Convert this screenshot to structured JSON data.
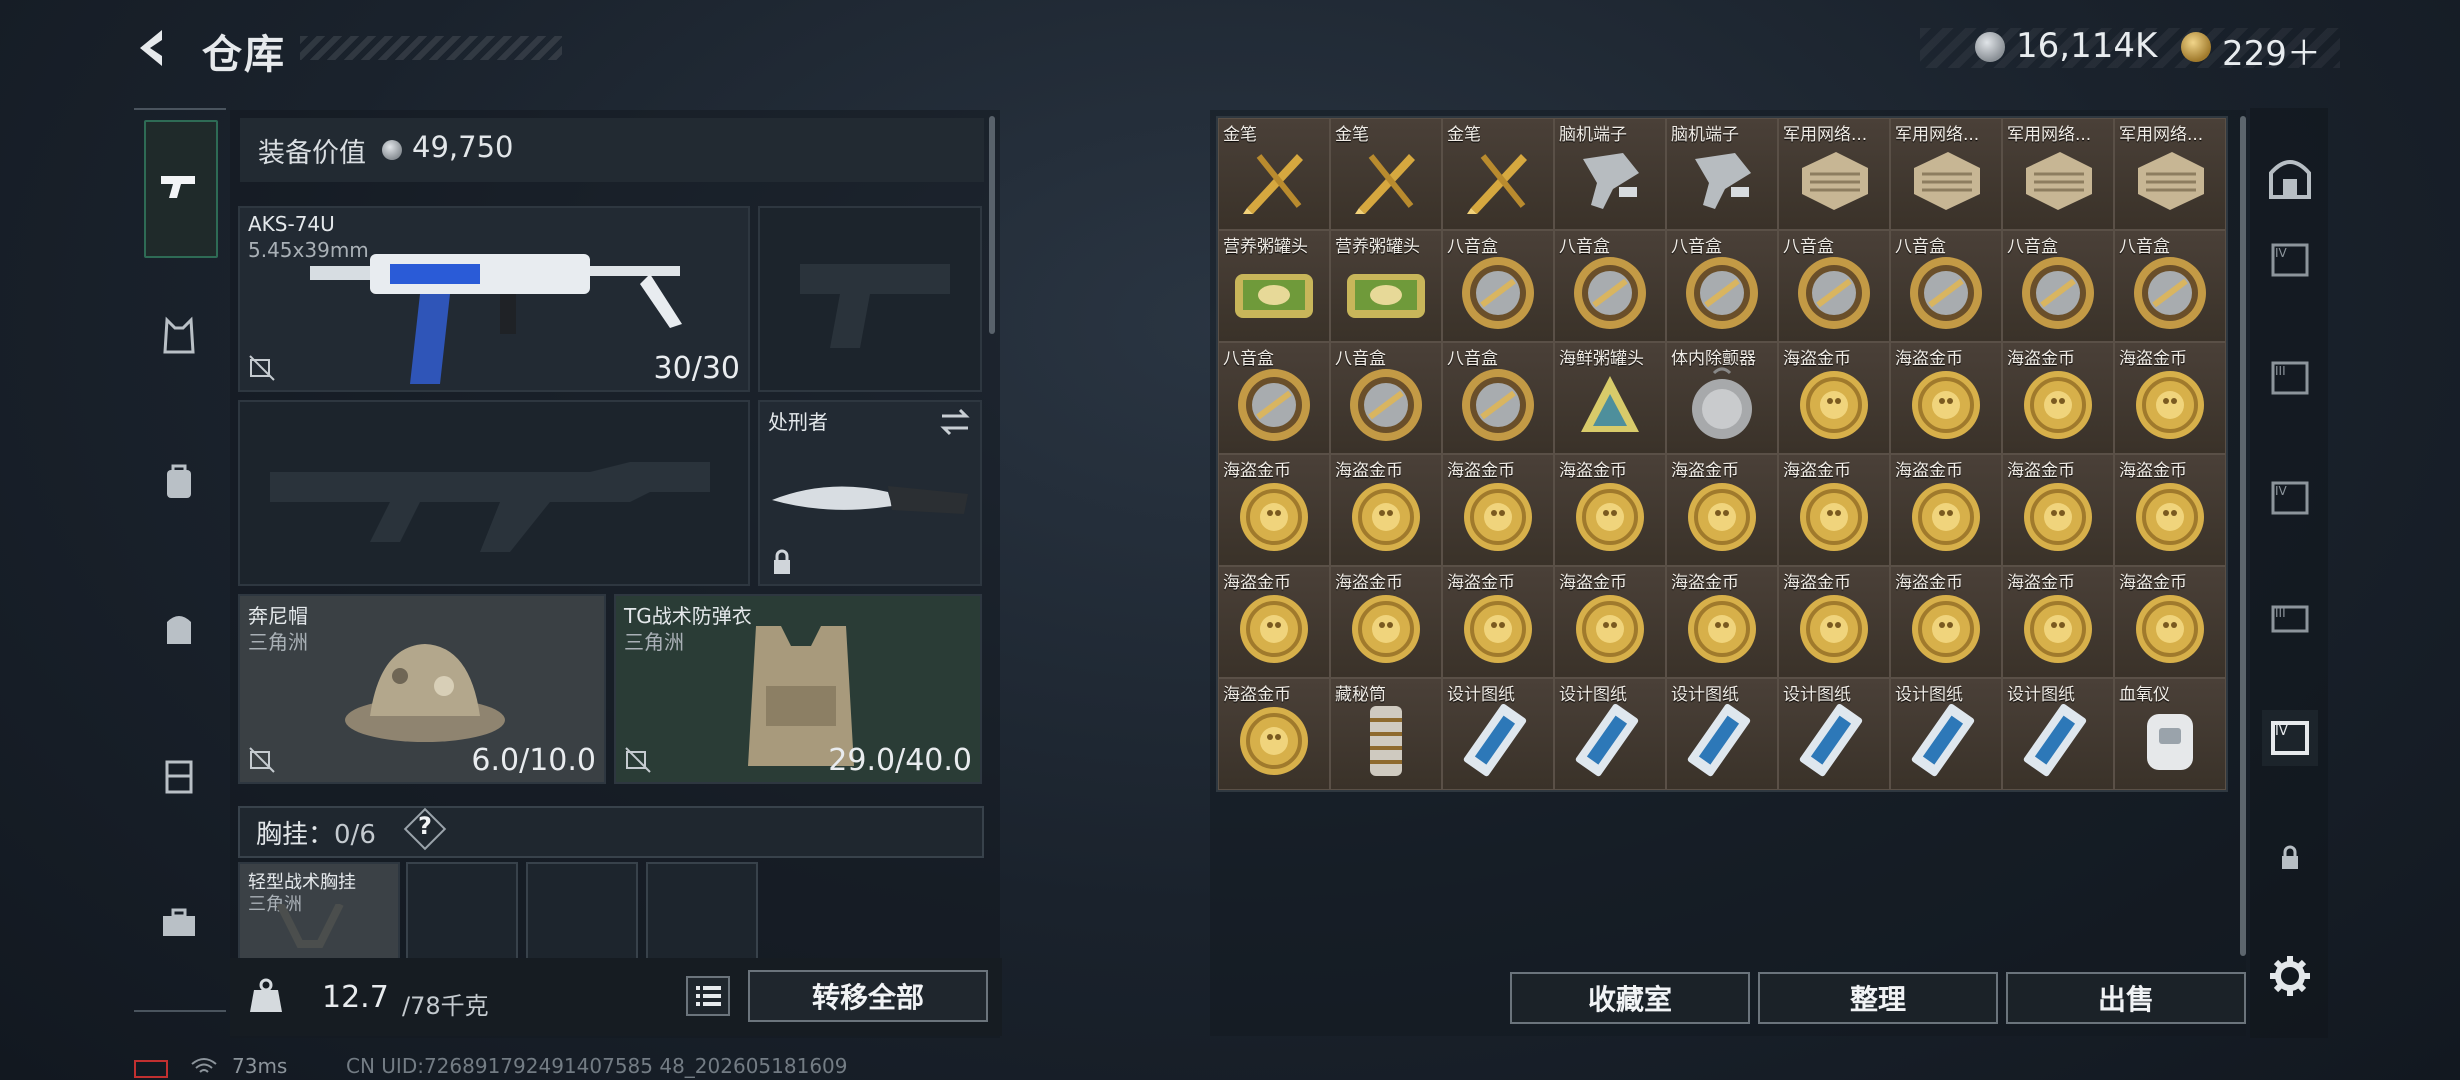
{
  "header": {
    "title": "仓库",
    "currency_silver": "16,114K",
    "currency_gold": "229＋"
  },
  "loadout": {
    "value_label": "装备价值",
    "value": "49,750",
    "primary": {
      "name": "AKS-74U",
      "caliber": "5.45x39mm",
      "ammo": "30/30"
    },
    "knife": {
      "name": "处刑者"
    },
    "helmet": {
      "name": "奔尼帽",
      "brand": "三角洲",
      "durability": "6.0/10.0"
    },
    "armor": {
      "name": "TG战术防弹衣",
      "brand": "三角洲",
      "durability": "29.0/40.0"
    },
    "rig": {
      "label": "胸挂：",
      "count": "0/6",
      "help": "?",
      "item_name": "轻型战术胸挂",
      "item_brand": "三角洲"
    },
    "weight_value": "12.7",
    "weight_max": "/78千克",
    "transfer_all": "转移全部"
  },
  "stash": {
    "items": [
      {
        "label": "金笔",
        "icon": "pen"
      },
      {
        "label": "金笔",
        "icon": "pen"
      },
      {
        "label": "金笔",
        "icon": "pen"
      },
      {
        "label": "脑机端子",
        "icon": "chip"
      },
      {
        "label": "脑机端子",
        "icon": "chip"
      },
      {
        "label": "军用网络...",
        "icon": "net"
      },
      {
        "label": "军用网络...",
        "icon": "net"
      },
      {
        "label": "军用网络...",
        "icon": "net"
      },
      {
        "label": "军用网络...",
        "icon": "net"
      },
      {
        "label": "营养粥罐头",
        "icon": "can"
      },
      {
        "label": "营养粥罐头",
        "icon": "can"
      },
      {
        "label": "八音盒",
        "icon": "musicbox"
      },
      {
        "label": "八音盒",
        "icon": "musicbox"
      },
      {
        "label": "八音盒",
        "icon": "musicbox"
      },
      {
        "label": "八音盒",
        "icon": "musicbox"
      },
      {
        "label": "八音盒",
        "icon": "musicbox"
      },
      {
        "label": "八音盒",
        "icon": "musicbox"
      },
      {
        "label": "八音盒",
        "icon": "musicbox"
      },
      {
        "label": "八音盒",
        "icon": "musicbox"
      },
      {
        "label": "八音盒",
        "icon": "musicbox"
      },
      {
        "label": "八音盒",
        "icon": "musicbox"
      },
      {
        "label": "海鲜粥罐头",
        "icon": "seafood"
      },
      {
        "label": "体内除颤器",
        "icon": "defib"
      },
      {
        "label": "海盗金币",
        "icon": "coin"
      },
      {
        "label": "海盗金币",
        "icon": "coin"
      },
      {
        "label": "海盗金币",
        "icon": "coin"
      },
      {
        "label": "海盗金币",
        "icon": "coin"
      },
      {
        "label": "海盗金币",
        "icon": "coin"
      },
      {
        "label": "海盗金币",
        "icon": "coin"
      },
      {
        "label": "海盗金币",
        "icon": "coin"
      },
      {
        "label": "海盗金币",
        "icon": "coin"
      },
      {
        "label": "海盗金币",
        "icon": "coin"
      },
      {
        "label": "海盗金币",
        "icon": "coin"
      },
      {
        "label": "海盗金币",
        "icon": "coin"
      },
      {
        "label": "海盗金币",
        "icon": "coin"
      },
      {
        "label": "海盗金币",
        "icon": "coin"
      },
      {
        "label": "海盗金币",
        "icon": "coin"
      },
      {
        "label": "海盗金币",
        "icon": "coin"
      },
      {
        "label": "海盗金币",
        "icon": "coin"
      },
      {
        "label": "海盗金币",
        "icon": "coin"
      },
      {
        "label": "海盗金币",
        "icon": "coin"
      },
      {
        "label": "海盗金币",
        "icon": "coin"
      },
      {
        "label": "海盗金币",
        "icon": "coin"
      },
      {
        "label": "海盗金币",
        "icon": "coin"
      },
      {
        "label": "海盗金币",
        "icon": "coin"
      },
      {
        "label": "海盗金币",
        "icon": "coin"
      },
      {
        "label": "藏秘筒",
        "icon": "cryptex"
      },
      {
        "label": "设计图纸",
        "icon": "blueprint"
      },
      {
        "label": "设计图纸",
        "icon": "blueprint"
      },
      {
        "label": "设计图纸",
        "icon": "blueprint"
      },
      {
        "label": "设计图纸",
        "icon": "blueprint"
      },
      {
        "label": "设计图纸",
        "icon": "blueprint"
      },
      {
        "label": "设计图纸",
        "icon": "blueprint"
      },
      {
        "label": "血氧仪",
        "icon": "oximeter"
      }
    ],
    "buttons": {
      "collection": "收藏室",
      "organize": "整理",
      "sell": "出售"
    }
  },
  "footer": {
    "ping": "73ms",
    "uid": "CN UID:726891792491407585 48_202605181609"
  },
  "colors": {
    "accent_green": "#2e6b55",
    "stash_bg": "#4a4038",
    "gold": "#d7b04a"
  }
}
